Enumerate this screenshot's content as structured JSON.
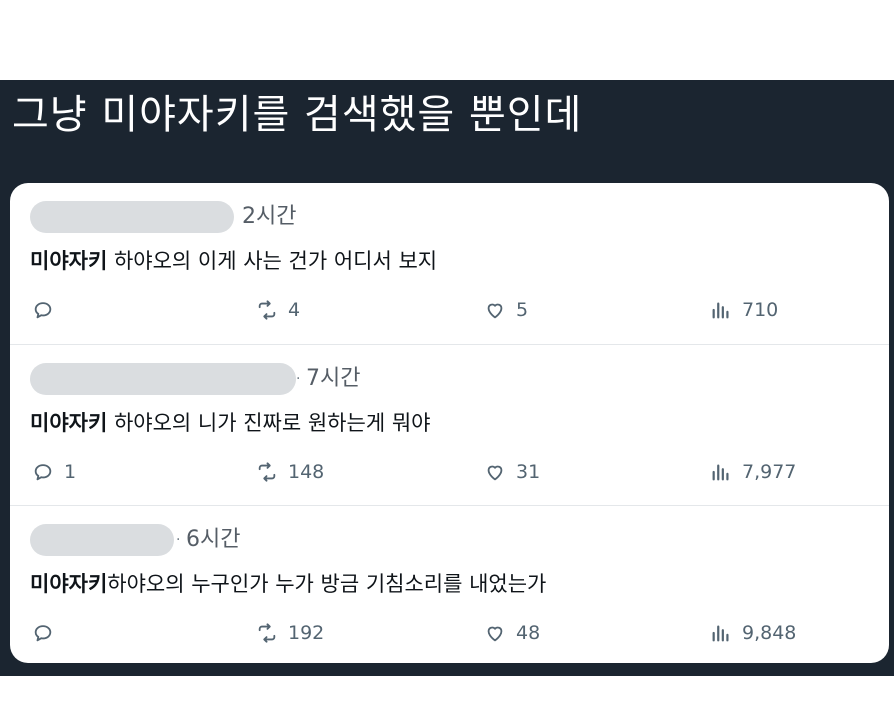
{
  "headline": "그냥 미야자키를 검색했을 뿐인데",
  "tweets": [
    {
      "time": "2시간",
      "keyword": "미야자키",
      "text": " 하야오의 이게 사는 건가 어디서 보지",
      "replies": "",
      "retweets": "4",
      "likes": "5",
      "views": "710"
    },
    {
      "time": "7시간",
      "keyword": "미야자키",
      "text": " 하야오의 니가 진짜로 원하는게 뭐야",
      "replies": "1",
      "retweets": "148",
      "likes": "31",
      "views": "7,977"
    },
    {
      "time": "6시간",
      "keyword": "미야자키",
      "text": "하야오의 누구인가 누가 방금 기침소리를 내었는가",
      "replies": "",
      "retweets": "192",
      "likes": "48",
      "views": "9,848"
    }
  ],
  "icons": {
    "reply": "reply-icon",
    "retweet": "retweet-icon",
    "like": "heart-icon",
    "views": "views-icon"
  },
  "colors": {
    "banner_background": "#1b2530",
    "card_background": "#ffffff",
    "text": "#0f1419",
    "muted": "#536471"
  }
}
